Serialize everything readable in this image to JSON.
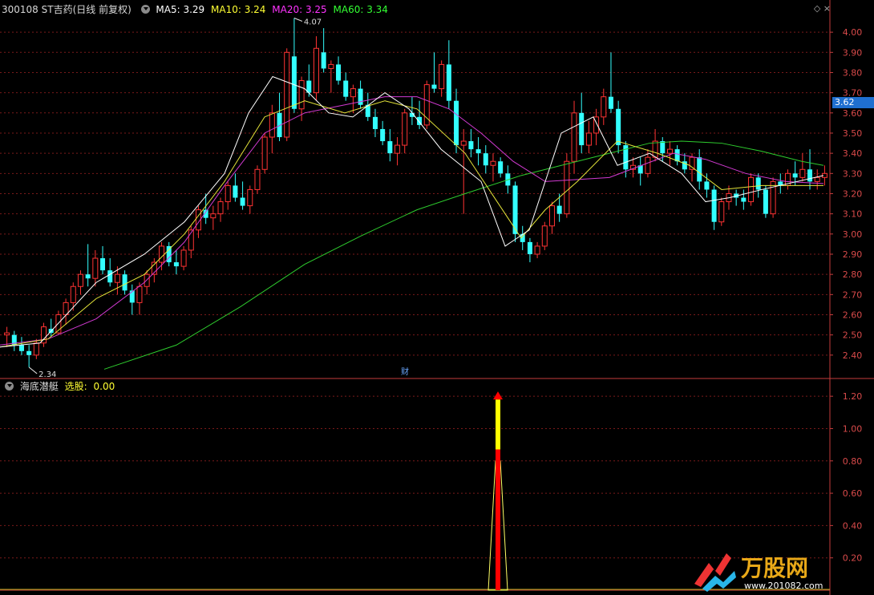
{
  "header": {
    "title": "300108 ST吉药(日线 前复权)",
    "ma": [
      {
        "label": "MA5: 3.29",
        "color": "#ffffff"
      },
      {
        "label": "MA10: 3.24",
        "color": "#ffff33"
      },
      {
        "label": "MA20: 3.25",
        "color": "#ff33ff"
      },
      {
        "label": "MA60: 3.34",
        "color": "#33ff33"
      }
    ],
    "icons": "◇  ×"
  },
  "price_panel": {
    "axis_labels": [
      "4.00",
      "3.90",
      "3.80",
      "3.70",
      "3.60",
      "3.50",
      "3.40",
      "3.30",
      "3.20",
      "3.10",
      "3.00",
      "2.90",
      "2.80",
      "2.70",
      "2.60",
      "2.50",
      "2.40"
    ],
    "current_price": "3.62",
    "high_label": "4.07",
    "low_label": "2.34",
    "event_marker": "财"
  },
  "indicator_panel": {
    "name": "海底潜艇",
    "signal_label": "选股:",
    "signal_value": "0.00",
    "axis_labels": [
      "1.20",
      "1.00",
      "0.80",
      "0.60",
      "0.40",
      "0.20"
    ]
  },
  "watermark": {
    "brand": "万股网",
    "url": "www.201082.com"
  },
  "colors": {
    "up": "#ff3333",
    "down": "#33ffff",
    "grid": "#7a1a1a",
    "axis": "#c43c3c",
    "signal": "#ff0000",
    "signal_top": "#ffff00"
  },
  "chart_data": {
    "type": "candlestick",
    "y_range": [
      2.3,
      4.08
    ],
    "candles": [
      [
        2.5,
        2.54,
        2.44,
        2.51
      ],
      [
        2.5,
        2.52,
        2.42,
        2.45
      ],
      [
        2.45,
        2.49,
        2.4,
        2.42
      ],
      [
        2.42,
        2.45,
        2.34,
        2.4
      ],
      [
        2.4,
        2.48,
        2.38,
        2.46
      ],
      [
        2.46,
        2.56,
        2.44,
        2.54
      ],
      [
        2.53,
        2.58,
        2.49,
        2.51
      ],
      [
        2.51,
        2.62,
        2.5,
        2.6
      ],
      [
        2.6,
        2.68,
        2.55,
        2.66
      ],
      [
        2.66,
        2.76,
        2.62,
        2.74
      ],
      [
        2.74,
        2.82,
        2.7,
        2.8
      ],
      [
        2.8,
        2.95,
        2.74,
        2.78
      ],
      [
        2.78,
        2.92,
        2.74,
        2.88
      ],
      [
        2.88,
        2.94,
        2.8,
        2.82
      ],
      [
        2.82,
        2.88,
        2.74,
        2.76
      ],
      [
        2.76,
        2.84,
        2.7,
        2.8
      ],
      [
        2.8,
        2.82,
        2.7,
        2.72
      ],
      [
        2.72,
        2.75,
        2.6,
        2.66
      ],
      [
        2.66,
        2.76,
        2.6,
        2.74
      ],
      [
        2.74,
        2.82,
        2.7,
        2.8
      ],
      [
        2.8,
        2.88,
        2.76,
        2.86
      ],
      [
        2.86,
        2.96,
        2.82,
        2.94
      ],
      [
        2.94,
        2.96,
        2.84,
        2.86
      ],
      [
        2.86,
        2.92,
        2.8,
        2.84
      ],
      [
        2.84,
        2.94,
        2.82,
        2.92
      ],
      [
        2.92,
        3.04,
        2.88,
        3.02
      ],
      [
        3.02,
        3.14,
        2.98,
        3.12
      ],
      [
        3.12,
        3.2,
        3.05,
        3.08
      ],
      [
        3.08,
        3.14,
        3.02,
        3.1
      ],
      [
        3.1,
        3.18,
        3.06,
        3.16
      ],
      [
        3.16,
        3.26,
        3.12,
        3.24
      ],
      [
        3.24,
        3.3,
        3.16,
        3.18
      ],
      [
        3.18,
        3.26,
        3.12,
        3.14
      ],
      [
        3.14,
        3.24,
        3.1,
        3.22
      ],
      [
        3.22,
        3.34,
        3.2,
        3.32
      ],
      [
        3.32,
        3.5,
        3.3,
        3.48
      ],
      [
        3.48,
        3.64,
        3.4,
        3.6
      ],
      [
        3.6,
        3.7,
        3.46,
        3.48
      ],
      [
        3.48,
        3.92,
        3.46,
        3.9
      ],
      [
        3.88,
        4.07,
        3.6,
        3.62
      ],
      [
        3.62,
        3.78,
        3.56,
        3.76
      ],
      [
        3.76,
        3.84,
        3.68,
        3.7
      ],
      [
        3.7,
        3.98,
        3.66,
        3.92
      ],
      [
        3.9,
        4.02,
        3.8,
        3.82
      ],
      [
        3.82,
        3.86,
        3.7,
        3.84
      ],
      [
        3.84,
        3.88,
        3.74,
        3.76
      ],
      [
        3.76,
        3.8,
        3.66,
        3.68
      ],
      [
        3.68,
        3.74,
        3.6,
        3.72
      ],
      [
        3.72,
        3.76,
        3.62,
        3.64
      ],
      [
        3.64,
        3.7,
        3.56,
        3.58
      ],
      [
        3.58,
        3.62,
        3.48,
        3.52
      ],
      [
        3.52,
        3.56,
        3.44,
        3.46
      ],
      [
        3.46,
        3.52,
        3.36,
        3.4
      ],
      [
        3.4,
        3.48,
        3.34,
        3.44
      ],
      [
        3.44,
        3.62,
        3.4,
        3.6
      ],
      [
        3.6,
        3.68,
        3.54,
        3.58
      ],
      [
        3.58,
        3.66,
        3.52,
        3.54
      ],
      [
        3.54,
        3.76,
        3.52,
        3.74
      ],
      [
        3.74,
        3.9,
        3.7,
        3.72
      ],
      [
        3.72,
        3.86,
        3.68,
        3.84
      ],
      [
        3.84,
        3.96,
        3.62,
        3.66
      ],
      [
        3.66,
        3.72,
        3.4,
        3.44
      ],
      [
        3.44,
        3.52,
        3.1,
        3.46
      ],
      [
        3.46,
        3.52,
        3.38,
        3.42
      ],
      [
        3.42,
        3.48,
        3.34,
        3.4
      ],
      [
        3.4,
        3.44,
        3.3,
        3.34
      ],
      [
        3.34,
        3.4,
        3.26,
        3.36
      ],
      [
        3.36,
        3.38,
        3.28,
        3.3
      ],
      [
        3.3,
        3.34,
        3.2,
        3.24
      ],
      [
        3.24,
        3.26,
        2.96,
        3.0
      ],
      [
        3.0,
        3.04,
        2.92,
        2.96
      ],
      [
        2.96,
        2.98,
        2.86,
        2.9
      ],
      [
        2.9,
        2.96,
        2.88,
        2.94
      ],
      [
        2.94,
        3.06,
        2.92,
        3.04
      ],
      [
        3.04,
        3.16,
        3.0,
        3.14
      ],
      [
        3.14,
        3.2,
        3.06,
        3.1
      ],
      [
        3.1,
        3.4,
        3.08,
        3.36
      ],
      [
        3.36,
        3.66,
        3.3,
        3.6
      ],
      [
        3.6,
        3.7,
        3.4,
        3.44
      ],
      [
        3.44,
        3.56,
        3.4,
        3.5
      ],
      [
        3.5,
        3.62,
        3.44,
        3.58
      ],
      [
        3.58,
        3.72,
        3.54,
        3.68
      ],
      [
        3.68,
        3.9,
        3.6,
        3.62
      ],
      [
        3.62,
        3.66,
        3.4,
        3.44
      ],
      [
        3.44,
        3.46,
        3.28,
        3.32
      ],
      [
        3.32,
        3.38,
        3.28,
        3.34
      ],
      [
        3.34,
        3.38,
        3.24,
        3.3
      ],
      [
        3.3,
        3.42,
        3.28,
        3.38
      ],
      [
        3.38,
        3.52,
        3.36,
        3.46
      ],
      [
        3.46,
        3.48,
        3.36,
        3.4
      ],
      [
        3.4,
        3.46,
        3.34,
        3.42
      ],
      [
        3.42,
        3.44,
        3.34,
        3.36
      ],
      [
        3.36,
        3.4,
        3.3,
        3.32
      ],
      [
        3.32,
        3.4,
        3.26,
        3.38
      ],
      [
        3.38,
        3.42,
        3.22,
        3.26
      ],
      [
        3.26,
        3.3,
        3.18,
        3.22
      ],
      [
        3.22,
        3.24,
        3.02,
        3.06
      ],
      [
        3.06,
        3.18,
        3.04,
        3.16
      ],
      [
        3.16,
        3.24,
        3.12,
        3.2
      ],
      [
        3.2,
        3.22,
        3.14,
        3.18
      ],
      [
        3.18,
        3.22,
        3.12,
        3.16
      ],
      [
        3.16,
        3.3,
        3.14,
        3.28
      ],
      [
        3.28,
        3.3,
        3.18,
        3.22
      ],
      [
        3.22,
        3.24,
        3.08,
        3.1
      ],
      [
        3.1,
        3.28,
        3.08,
        3.26
      ],
      [
        3.26,
        3.3,
        3.2,
        3.24
      ],
      [
        3.24,
        3.32,
        3.22,
        3.3
      ],
      [
        3.3,
        3.36,
        3.24,
        3.28
      ],
      [
        3.28,
        3.4,
        3.26,
        3.32
      ],
      [
        3.32,
        3.42,
        3.22,
        3.26
      ],
      [
        3.26,
        3.32,
        3.22,
        3.28
      ],
      [
        3.28,
        3.34,
        3.24,
        3.3
      ]
    ],
    "ma60": [
      [
        130,
        2.33
      ],
      [
        220,
        2.45
      ],
      [
        300,
        2.64
      ],
      [
        380,
        2.85
      ],
      [
        450,
        2.99
      ],
      [
        520,
        3.12
      ],
      [
        580,
        3.2
      ],
      [
        650,
        3.29
      ],
      [
        700,
        3.34
      ],
      [
        760,
        3.4
      ],
      [
        810,
        3.45
      ],
      [
        850,
        3.46
      ],
      [
        900,
        3.45
      ],
      [
        950,
        3.41
      ],
      [
        1000,
        3.36
      ],
      [
        1027,
        3.34
      ]
    ],
    "ma20": [
      [
        0,
        2.45
      ],
      [
        60,
        2.48
      ],
      [
        120,
        2.58
      ],
      [
        180,
        2.76
      ],
      [
        230,
        2.96
      ],
      [
        280,
        3.24
      ],
      [
        330,
        3.5
      ],
      [
        380,
        3.6
      ],
      [
        430,
        3.64
      ],
      [
        480,
        3.68
      ],
      [
        520,
        3.68
      ],
      [
        560,
        3.62
      ],
      [
        600,
        3.5
      ],
      [
        640,
        3.36
      ],
      [
        680,
        3.26
      ],
      [
        720,
        3.27
      ],
      [
        760,
        3.28
      ],
      [
        800,
        3.34
      ],
      [
        840,
        3.4
      ],
      [
        880,
        3.37
      ],
      [
        930,
        3.3
      ],
      [
        980,
        3.26
      ],
      [
        1027,
        3.25
      ]
    ],
    "ma10": [
      [
        0,
        2.44
      ],
      [
        60,
        2.48
      ],
      [
        120,
        2.68
      ],
      [
        180,
        2.8
      ],
      [
        230,
        3.0
      ],
      [
        280,
        3.26
      ],
      [
        330,
        3.58
      ],
      [
        380,
        3.66
      ],
      [
        430,
        3.6
      ],
      [
        480,
        3.66
      ],
      [
        520,
        3.62
      ],
      [
        580,
        3.4
      ],
      [
        620,
        3.16
      ],
      [
        650,
        2.98
      ],
      [
        680,
        3.12
      ],
      [
        720,
        3.26
      ],
      [
        770,
        3.46
      ],
      [
        820,
        3.4
      ],
      [
        860,
        3.34
      ],
      [
        900,
        3.22
      ],
      [
        950,
        3.24
      ],
      [
        1027,
        3.24
      ]
    ],
    "ma5": [
      [
        0,
        2.44
      ],
      [
        50,
        2.46
      ],
      [
        120,
        2.76
      ],
      [
        180,
        2.9
      ],
      [
        230,
        3.06
      ],
      [
        280,
        3.3
      ],
      [
        310,
        3.6
      ],
      [
        340,
        3.78
      ],
      [
        380,
        3.72
      ],
      [
        410,
        3.6
      ],
      [
        440,
        3.58
      ],
      [
        480,
        3.7
      ],
      [
        510,
        3.62
      ],
      [
        550,
        3.42
      ],
      [
        600,
        3.26
      ],
      [
        630,
        2.94
      ],
      [
        660,
        3.02
      ],
      [
        700,
        3.5
      ],
      [
        740,
        3.58
      ],
      [
        770,
        3.34
      ],
      [
        810,
        3.4
      ],
      [
        850,
        3.3
      ],
      [
        880,
        3.16
      ],
      [
        910,
        3.18
      ],
      [
        950,
        3.22
      ],
      [
        1027,
        3.29
      ]
    ],
    "signal": {
      "x": 621,
      "value": 1.0
    }
  }
}
